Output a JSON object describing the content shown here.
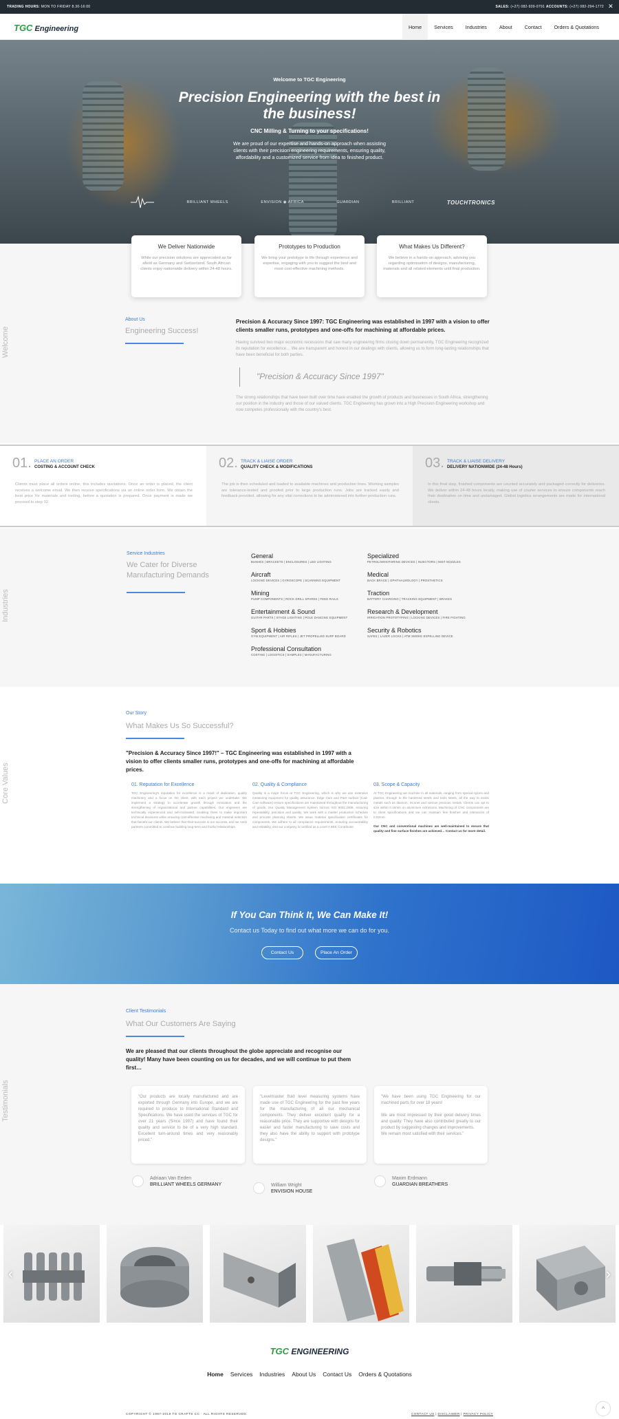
{
  "topbar": {
    "hours_label": "TRADING HOURS:",
    "hours_value": "MON TO FRIDAY 8.30-16:00",
    "sales_label": "SALES:",
    "sales_value": "(+27) 082-939-0791",
    "accounts_label": "ACCOUNTS:",
    "accounts_value": "(+27) 082-294-1772",
    "close": "✕"
  },
  "logo": {
    "tgc": "TGC",
    "text": "Engineering"
  },
  "nav": [
    "Home",
    "Services",
    "Industries",
    "About",
    "Contact",
    "Orders & Quotations"
  ],
  "hero": {
    "welcome": "Welcome to TGC Engineering",
    "title": "Precision Engineering with the best in the business!",
    "subtitle": "CNC Milling & Turning to your specifications!",
    "body": "We are proud of our expertise and hands-on approach when assisting clients with their precision engineering requirements, ensuring quality, affordability and a customized service from idea to finished product.",
    "brands": [
      "BRILLIANT WHEELS",
      "ENVISION ◉ AFRICA",
      "GUARDIAN",
      "BRILLIANT",
      "TOUCHTRONICS"
    ]
  },
  "cards": [
    {
      "title": "We Deliver Nationwide",
      "text": "While our precision solutions are appreciated as far afield as Germany and Switzerland, South African clients enjoy nationwide delivery within 24-48 hours."
    },
    {
      "title": "Prototypes to Production",
      "text": "We bring your prototype to life through experience and expertise, engaging with you to suggest the best and most cost-effective machining methods."
    },
    {
      "title": "What Makes Us Different?",
      "text": "We believe in a hands-on approach, advising you regarding optimisation of designs, manufacturing, materials and all related elements until final production."
    }
  ],
  "welcome": {
    "side": "Welcome",
    "eyebrow": "About Us",
    "heading": "Engineering Success!",
    "lead": "Precision & Accuracy Since 1997: TGC Engineering was established in 1997 with a vision to offer clients smaller runs, prototypes and one-offs for machining at affordable prices.",
    "p1": "Having survived two major economic recessions that saw many engineering firms closing down permanently, TGC Engineering recognized its reputation for excellence… We are transparent and honest in our dealings with clients, allowing us to form long-lasting relationships that have been beneficial for both parties.",
    "quote": "\"Precision & Accuracy Since 1997\"",
    "p2": "The strong relationships that have been built over time have enabled the growth of products and businesses in South Africa, strengthening our position in the industry and those of our valued clients. TGC Engineering has grown into a High Precision Engineering workshop and now competes professionally with the country's best."
  },
  "steps": [
    {
      "num": "01.",
      "title": "PLACE AN ORDER",
      "sub": "COSTING & ACCOUNT CHECK",
      "text": "Clients must place all orders online, this includes quotations. Once an order is placed, the client receives a welcome email. We then receive specifications via an online order form. We obtain the best price for materials and tooling, before a quotation is prepared. Once payment is made we proceed to step 02."
    },
    {
      "num": "02.",
      "title": "TRACK & LIAISE ORDER",
      "sub": "QUALITY CHECK & MODIFICATIONS",
      "text": "The job is then scheduled and loaded to available machines and production lines. Working samples are tolerance-tested and proofed prior to large production runs. Jobs are tracked easily and feedback provided, allowing for any vital corrections to be administered into further production runs."
    },
    {
      "num": "03.",
      "title": "TRACK & LIAISE DELIVERY",
      "sub": "DELIVERY NATIONWIDE (24-48 Hours)",
      "text": "In this final step, finished components are counted accurately and packaged correctly for deliveries. We deliver within 24-48 hours locally, making use of courier services to ensure components reach their destination on time and undamaged. Global logistics arrangements are made for international clients."
    }
  ],
  "industries": {
    "side": "Industries",
    "eyebrow": "Service Industries",
    "heading": "We Cater for Diverse Manufacturing Demands",
    "items": [
      {
        "name": "General",
        "sub": "BUSHES | BRACKETS | ENCLOSURES | LED LIGHTING"
      },
      {
        "name": "Specialized",
        "sub": "PETROL/MONITORING DEVICES | INJECTORS | MIST NOZZLES"
      },
      {
        "name": "Aircraft",
        "sub": "LOCKING DEVICES | GYROSCOPE | SCANNING EQUIPMENT"
      },
      {
        "name": "Medical",
        "sub": "BACK BRACE | OPHTHALMOLOGY | PROSTHETICS"
      },
      {
        "name": "Mining",
        "sub": "PUMP COMPONENTS | ROCK DRILL SPARES | FEED RAILS"
      },
      {
        "name": "Traction",
        "sub": "BATTERY CHARGING | TRACKING EQUIPMENT | BRAKES"
      },
      {
        "name": "Entertainment & Sound",
        "sub": "GUITAR PARTS | STAGE LIGHTING | POLE DANCING EQUIPMENT"
      },
      {
        "name": "Research & Development",
        "sub": "IRRIGATION PROTOTYPING | LOCKING DEVICES | FIRE FIGHTING"
      },
      {
        "name": "Sport & Hobbies",
        "sub": "GYM EQUIPMENT | AIR RIFLES | JET PROPELLED SURF BOARD"
      },
      {
        "name": "Security & Robotics",
        "sub": "SAFES | LAZER LOCKS | ATM SMOKE EXPELLING DEVICE"
      },
      {
        "name": "Professional Consultation",
        "sub": "COSTING | LOGISTICS | SAMPLES | MANUFACTURING"
      }
    ]
  },
  "values": {
    "side": "Core Values",
    "eyebrow": "Our Story",
    "heading": "What Makes Us So Successful?",
    "lead": "\"Precision & Accuracy Since 1997!\" – TGC Engineering was established in 1997 with a vision to offer clients smaller runs, prototypes and one-offs for machining at affordable prices.",
    "cols": [
      {
        "title": "01. Reputation for Excellence",
        "text": "TGC Engineering's reputation for excellence is a result of dedication, quality machinery and a focus on the client, with each project we undertake. We implement a strategy to accelerate growth through innovation and the strengthening of organizational and partner capabilities. Our engineers are technically experienced and self-motivated, enabling them to make important technical decisions while ensuring cost-effective machining and material selection that benefit our clients. We believe that their success is our success, and we seek partners committed to continue building long-term and fruitful relationships."
      },
      {
        "title": "02. Quality & Compliance",
        "text": "Quality is a major focus at TGC Engineering, which is why we use extensive measuring equipment for quality assurance. Edge Cam and Pare surface (Cad-Cam software) ensure specifications are maintained throughout the manufacturing of goods. Our Quality Management System mirrors ISO 9001:2008, ensuring repeatability, precision and quality. We work with a master production schedule and process planning sheets. We issue material specification certificates for components. We adhere to all compliance requirements, ensuring accountability and reliability, and our company is certified as a Level 4 BEE Contributor."
      },
      {
        "title": "03. Scope & Capacity",
        "text": "At TGC Engineering we machine in all materials, ranging from special nylons and plastics, through to the hardened steels and tools steels, all the way to exotic metals such as titanium, Inconel and various precious metals. Clients can opt to size within 0.15mm on aluminium extrusions. Machining of CNC components are to client specifications and we can maintain fine finishes and tolerances of 0.02mm.",
        "bold": "Our CNC and conventional machines are well-maintained to ensure that quality and fine surface finishes are achieved… Contact us for more detail."
      }
    ]
  },
  "cta": {
    "heading": "If You Can Think It, We Can Make It!",
    "sub": "Contact us Today to find out what more we can do for you.",
    "btn1": "Contact Us",
    "btn2": "Place An Order"
  },
  "testimonials": {
    "side": "Testimonials",
    "eyebrow": "Client Testimonials",
    "heading": "What Our Customers Are Saying",
    "lead": "We are pleased that our clients throughout the globe appreciate and recognise our quality! Many have been counting on us for decades, and we will continue to put them first…",
    "items": [
      {
        "quote": "\"Our products are locally manufactured and are exported through Germany into Europe, and we are required to produce to International Standard and Specifications. We have used the services of TGC for over 21 years (Since 1997) and have found their quality and service to be of a very high standard. Excellent turn-around times and very reasonably priced.\"",
        "name": "Adriaan Van Eeden",
        "company": "BRILLIANT WHEELS GERMANY"
      },
      {
        "quote": "\"Levelmaster fluid level measuring systems have made use of TGC Engineering for the past few years for the manufacturing of all our mechanical components. They deliver excellent quality for a reasonable price. They are supportive with designs for easier and faster manufacturing to save costs and they also have the ability to support with prototype designs.\"",
        "name": "William Wright",
        "company": "ENVISION HOUSE"
      },
      {
        "quote": "\"We have been using TGC Engineering for our machined parts for over 18 years!\n\nWe are most impressed by their good delivery times and quality. They have also contributed greatly to our product by suggesting changes and improvements.\nWe remain most satisfied with their services.\"",
        "name": "Maxim Erdmann",
        "company": "GUARDIAN BREATHERS"
      }
    ]
  },
  "gallery": {
    "prev": "‹",
    "next": "›"
  },
  "footer": {
    "logo": "ENGINEERING",
    "nav": [
      "Home",
      "Services",
      "Industries",
      "About Us",
      "Contact Us",
      "Orders & Quotations"
    ],
    "copyright": "COPYRIGHT © 1997-2019 TG CRAFTS CC · ALL RIGHTS RESERVED.",
    "links": [
      "CONTACT US",
      "DISCLAIMER",
      "PRIVACY POLICY"
    ],
    "totop": "^"
  },
  "colors": {
    "accent": "#3d7ad8",
    "topbar": "#232b33",
    "cta_start": "#79b6d8",
    "cta_end": "#1d58c4"
  }
}
